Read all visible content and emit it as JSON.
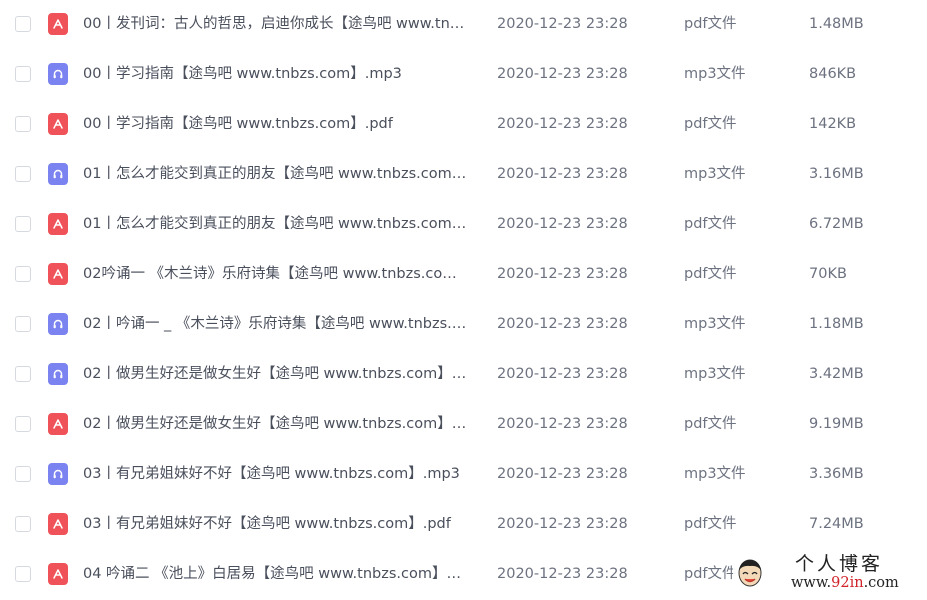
{
  "files": [
    {
      "icon": "pdf-file-icon",
      "kind": "pdf",
      "name": "00丨发刊词：古人的哲思，启迪你成长【途鸟吧 www.tn…",
      "date": "2020-12-23 23:28",
      "type": "pdf文件",
      "size": "1.48MB"
    },
    {
      "icon": "mp3-file-icon",
      "kind": "mp3",
      "name": "00丨学习指南【途鸟吧 www.tnbzs.com】.mp3",
      "date": "2020-12-23 23:28",
      "type": "mp3文件",
      "size": "846KB"
    },
    {
      "icon": "pdf-file-icon",
      "kind": "pdf",
      "name": "00丨学习指南【途鸟吧 www.tnbzs.com】.pdf",
      "date": "2020-12-23 23:28",
      "type": "pdf文件",
      "size": "142KB"
    },
    {
      "icon": "mp3-file-icon",
      "kind": "mp3",
      "name": "01丨怎么才能交到真正的朋友【途鸟吧 www.tnbzs.com…",
      "date": "2020-12-23 23:28",
      "type": "mp3文件",
      "size": "3.16MB"
    },
    {
      "icon": "pdf-file-icon",
      "kind": "pdf",
      "name": "01丨怎么才能交到真正的朋友【途鸟吧 www.tnbzs.com…",
      "date": "2020-12-23 23:28",
      "type": "pdf文件",
      "size": "6.72MB"
    },
    {
      "icon": "pdf-file-icon",
      "kind": "pdf",
      "name": "02吟诵一 《木兰诗》乐府诗集【途鸟吧 www.tnbzs.co…",
      "date": "2020-12-23 23:28",
      "type": "pdf文件",
      "size": "70KB"
    },
    {
      "icon": "mp3-file-icon",
      "kind": "mp3",
      "name": "02丨吟诵一 _ 《木兰诗》乐府诗集【途鸟吧 www.tnbzs.…",
      "date": "2020-12-23 23:28",
      "type": "mp3文件",
      "size": "1.18MB"
    },
    {
      "icon": "mp3-file-icon",
      "kind": "mp3",
      "name": "02丨做男生好还是做女生好【途鸟吧 www.tnbzs.com】…",
      "date": "2020-12-23 23:28",
      "type": "mp3文件",
      "size": "3.42MB"
    },
    {
      "icon": "pdf-file-icon",
      "kind": "pdf",
      "name": "02丨做男生好还是做女生好【途鸟吧 www.tnbzs.com】…",
      "date": "2020-12-23 23:28",
      "type": "pdf文件",
      "size": "9.19MB"
    },
    {
      "icon": "mp3-file-icon",
      "kind": "mp3",
      "name": "03丨有兄弟姐妹好不好【途鸟吧 www.tnbzs.com】.mp3",
      "date": "2020-12-23 23:28",
      "type": "mp3文件",
      "size": "3.36MB"
    },
    {
      "icon": "pdf-file-icon",
      "kind": "pdf",
      "name": "03丨有兄弟姐妹好不好【途鸟吧 www.tnbzs.com】.pdf",
      "date": "2020-12-23 23:28",
      "type": "pdf文件",
      "size": "7.24MB"
    },
    {
      "icon": "pdf-file-icon",
      "kind": "pdf",
      "name": "04 吟诵二 《池上》白居易【途鸟吧 www.tnbzs.com】…",
      "date": "2020-12-23 23:28",
      "type": "pdf文件",
      "size": ""
    }
  ],
  "watermark": {
    "title": "个人博客",
    "url_prefix": "www.",
    "url_highlight": "92in",
    "url_suffix": ".com"
  },
  "colors": {
    "pdf_icon": "#f0525a",
    "mp3_icon": "#7b83f0"
  }
}
